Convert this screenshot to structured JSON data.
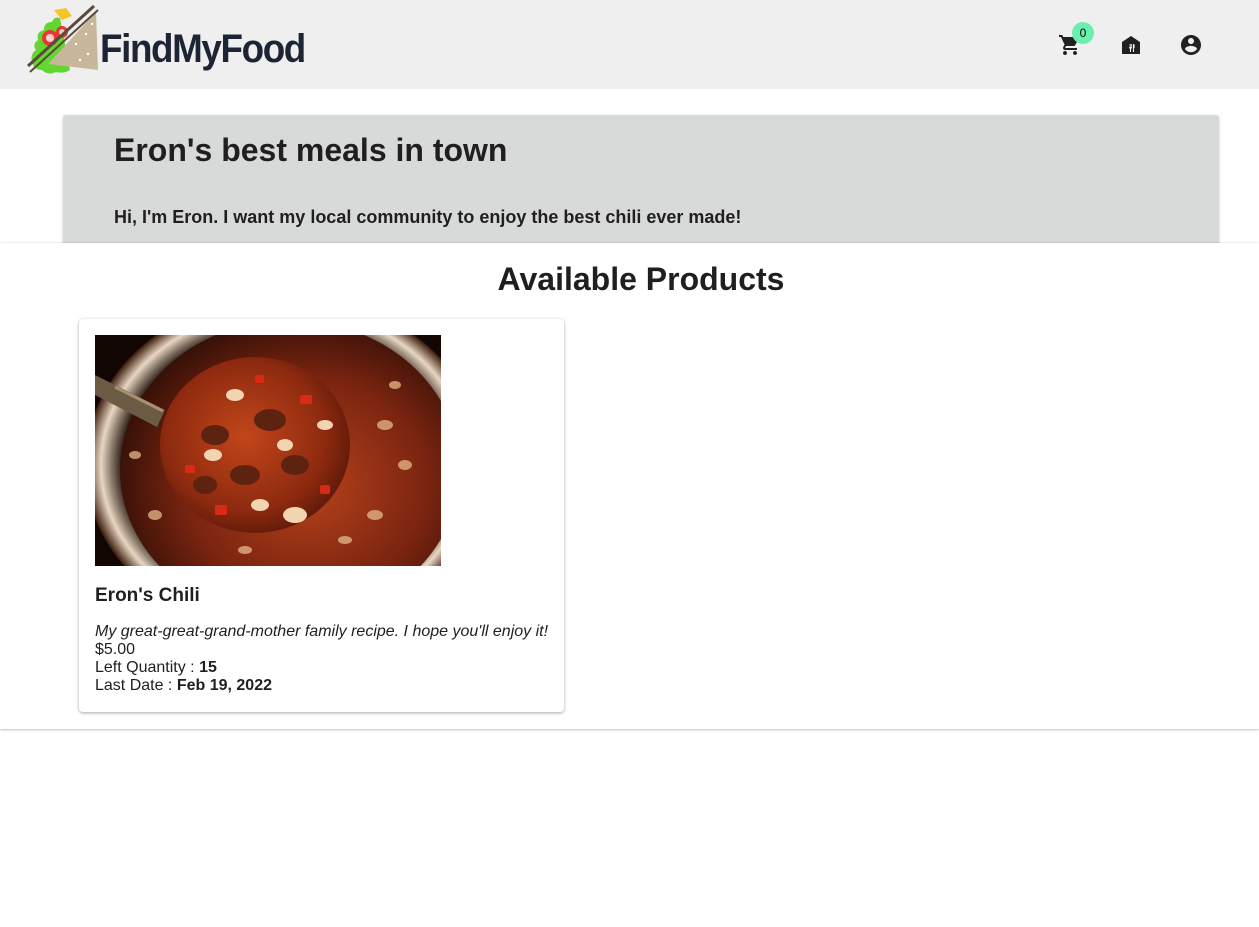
{
  "header": {
    "logo_text": "FindMyFood",
    "cart_count": "0",
    "icons": [
      "cart-icon",
      "storefront-icon",
      "account-circle-icon"
    ]
  },
  "hero": {
    "title": "Eron's best meals in town",
    "subtitle": "Hi, I'm Eron. I want my local community to enjoy the best chili ever made!"
  },
  "products": {
    "heading": "Available Products",
    "items": [
      {
        "name": "Eron's Chili",
        "description": "My great-great-grand-mother family recipe. I hope you'll enjoy it!",
        "price": "$5.00",
        "quantity_label": "Left Quantity : ",
        "quantity": "15",
        "date_label": "Last Date : ",
        "date": "Feb 19, 2022"
      }
    ]
  },
  "colors": {
    "navbar_bg": "#efefef",
    "hero_bg": "#d8dad9",
    "badge": "#69f0ae",
    "logo_text": "#1d2433"
  }
}
